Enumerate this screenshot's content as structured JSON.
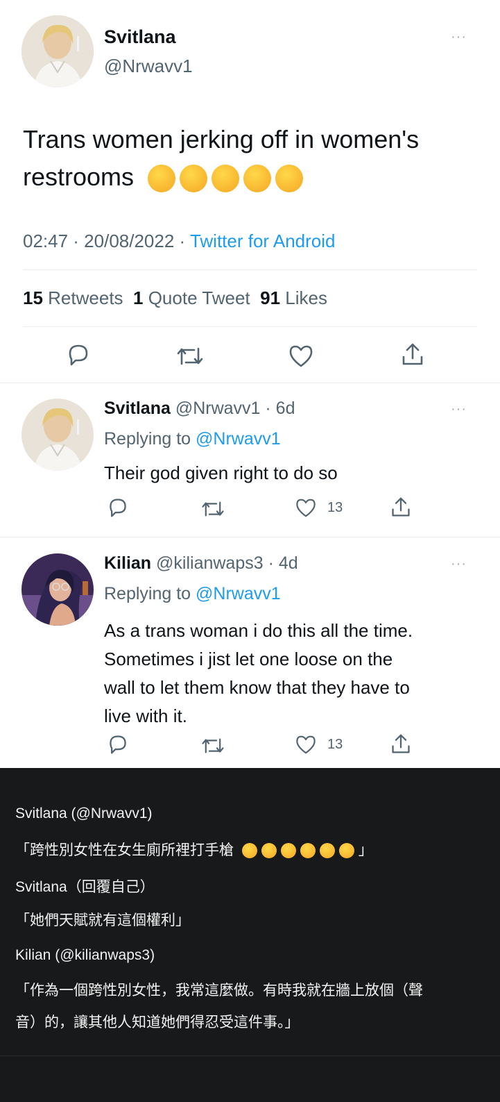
{
  "main_tweet": {
    "display_name": "Svitlana",
    "handle": "@Nrwavv1",
    "text": "Trans women jerking off in women's restrooms",
    "emoji_count": 5,
    "timestamp": "02:47 · 20/08/2022 ·",
    "source": "Twitter for Android",
    "retweets_count": "15",
    "retweets_label": "Retweets",
    "quotes_count": "1",
    "quotes_label": "Quote Tweet",
    "likes_count": "91",
    "likes_label": "Likes"
  },
  "replies": [
    {
      "display_name": "Svitlana",
      "handle_time": "@Nrwavv1 · 6d",
      "replying_label": "Replying to",
      "replying_handle": "@Nrwavv1",
      "text": "Their god given right to do so",
      "likes": "13"
    },
    {
      "display_name": "Kilian",
      "handle_time": "@kilianwaps3 · 4d",
      "replying_label": "Replying to",
      "replying_handle": "@Nrwavv1",
      "text_lines": [
        "As a trans woman i do this all the time.",
        "Sometimes i jist let one loose on the",
        "wall to let them know that they have to",
        "live with it."
      ],
      "likes": "13"
    }
  ],
  "translation": {
    "line1": "Svitlana (@Nrwavv1)",
    "line2": "「跨性別女性在女生廁所裡打手槍",
    "line2_end": "」",
    "line2_emoji_count": 6,
    "line3": "Svitlana（回覆自己）",
    "line4": "「她們天賦就有這個權利」",
    "line5": "Kilian (@kilianwaps3)",
    "line6": "「作為一個跨性別女性，我常這麼做。有時我就在牆上放個（聲",
    "line7": "音）的，讓其他人知道她們得忍受這件事。」"
  },
  "icons": {
    "reply": "reply-icon",
    "retweet": "retweet-icon",
    "like": "heart-icon",
    "share": "share-icon",
    "more": "more-icon",
    "emoji": "heart-eyes-emoji"
  },
  "colors": {
    "link": "#1d9bf0",
    "muted": "#536471",
    "dark_bg": "#18191b"
  }
}
